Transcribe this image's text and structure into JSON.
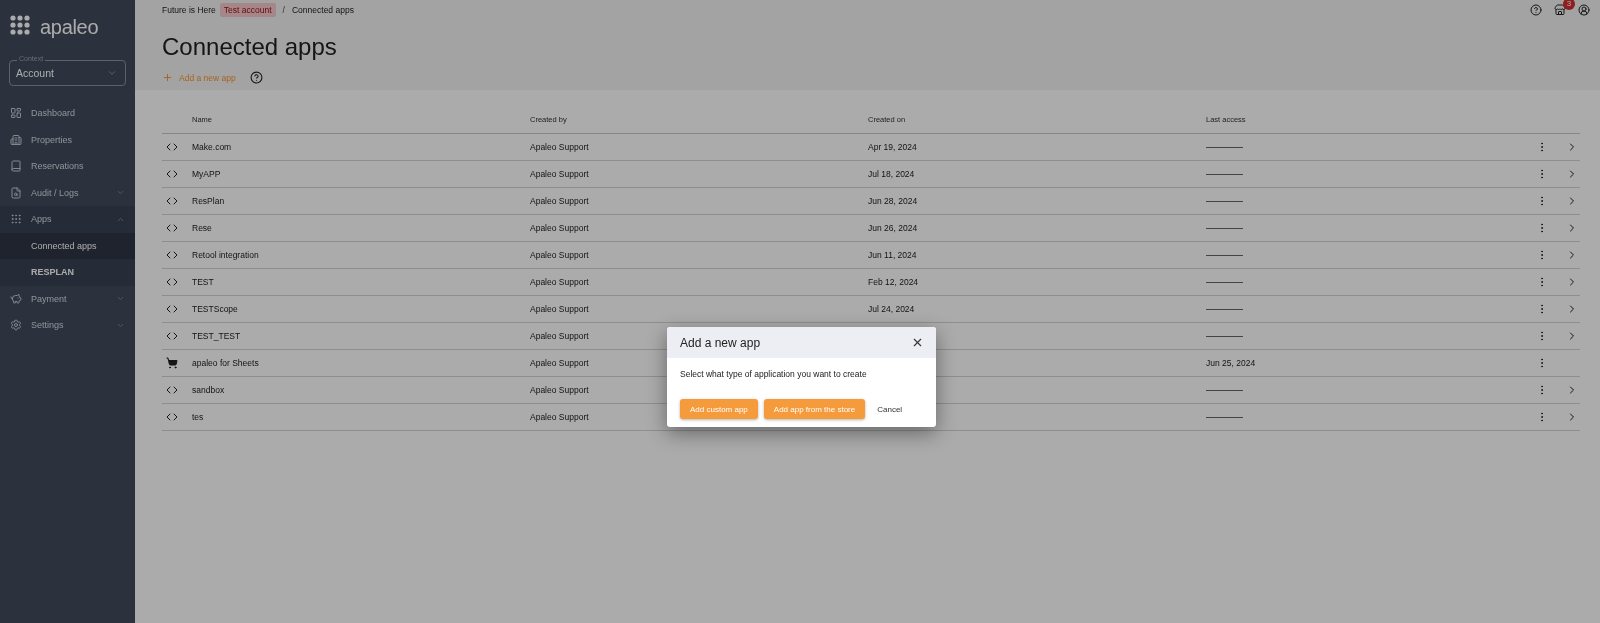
{
  "sidebar": {
    "logo": "apaleo",
    "context": {
      "label": "Context",
      "value": "Account"
    },
    "items": [
      {
        "label": "Dashboard"
      },
      {
        "label": "Properties"
      },
      {
        "label": "Reservations"
      },
      {
        "label": "Audit / Logs",
        "expanded": false
      },
      {
        "label": "Apps",
        "expanded": true,
        "children": [
          {
            "label": "Connected apps",
            "selected": true
          },
          {
            "label": "RESPLAN",
            "selected": false
          }
        ]
      },
      {
        "label": "Payment",
        "expanded": false
      },
      {
        "label": "Settings",
        "expanded": false
      }
    ]
  },
  "breadcrumb": [
    {
      "label": "Future is Here",
      "kind": "plain"
    },
    {
      "label": "Test account",
      "kind": "badge"
    },
    {
      "label": "/",
      "kind": "separator"
    },
    {
      "label": "Connected apps",
      "kind": "plain"
    }
  ],
  "header_icons": {
    "notification_count": "3"
  },
  "title": "Connected apps",
  "add_action": "Add a new app",
  "table": {
    "columns": [
      "Name",
      "Created by",
      "Created on",
      "Last access"
    ],
    "rows": [
      {
        "kind": "custom",
        "name": "Make.com",
        "created_by": "Apaleo Support",
        "created_on": "Apr 19, 2024"
      },
      {
        "kind": "custom",
        "name": "MyAPP",
        "created_by": "Apaleo Support",
        "created_on": "Jul 18, 2024"
      },
      {
        "kind": "custom",
        "name": "ResPlan",
        "created_by": "Apaleo Support",
        "created_on": "Jun 28, 2024"
      },
      {
        "kind": "custom",
        "name": "Rese",
        "created_by": "Apaleo Support",
        "created_on": "Jun 26, 2024"
      },
      {
        "kind": "custom",
        "name": "Retool integration",
        "created_by": "Apaleo Support",
        "created_on": "Jun 11, 2024"
      },
      {
        "kind": "custom",
        "name": "TEST",
        "created_by": "Apaleo Support",
        "created_on": "Feb 12, 2024"
      },
      {
        "kind": "custom",
        "name": "TESTScope",
        "created_by": "Apaleo Support",
        "created_on": "Jul 24, 2024"
      },
      {
        "kind": "custom",
        "name": "TEST_TEST",
        "created_by": "Apaleo Support"
      },
      {
        "kind": "store",
        "name": "apaleo for Sheets",
        "created_by": "Apaleo Support",
        "last_access": "Jun 25, 2024"
      },
      {
        "kind": "custom",
        "name": "sandbox",
        "created_by": "Apaleo Support"
      },
      {
        "kind": "custom",
        "name": "tes",
        "created_by": "Apaleo Support"
      }
    ]
  },
  "dialog": {
    "title": "Add a new app",
    "message": "Select what type of application you want to create",
    "buttons": [
      {
        "label": "Add custom app",
        "kind": "primary"
      },
      {
        "label": "Add app from the store",
        "kind": "primary"
      },
      {
        "label": "Cancel",
        "kind": "text"
      }
    ]
  }
}
